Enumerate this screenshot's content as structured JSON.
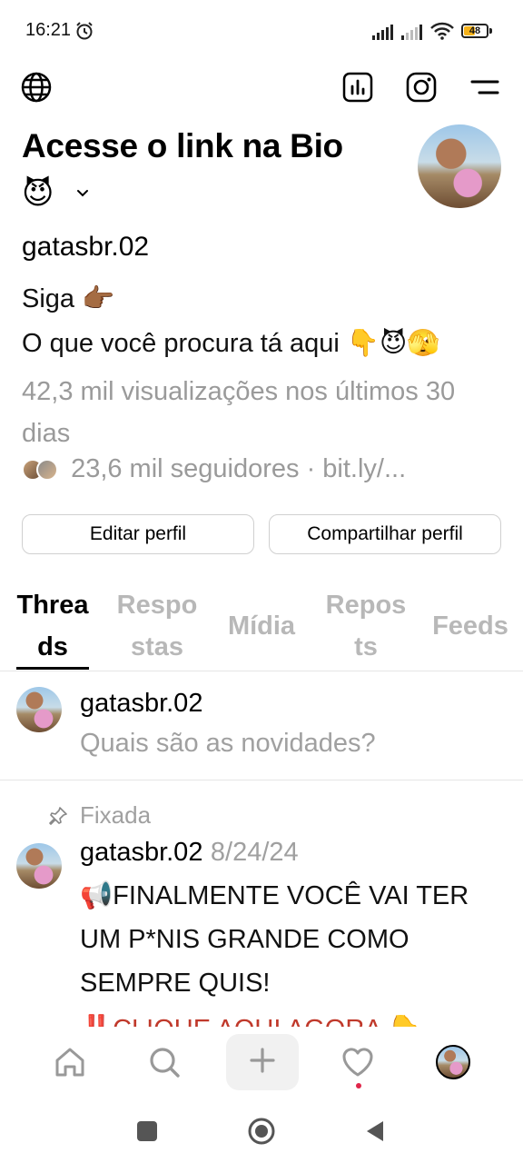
{
  "status_bar": {
    "time": "16:21",
    "battery": "48"
  },
  "profile": {
    "display_name": "Acesse o link na Bio",
    "name_emoji": "😈",
    "username": "gatasbr.02",
    "bio_line1": "Siga 👉🏾",
    "bio_line2": "O que você procura tá aqui 👇😈🫣",
    "views": "42,3 mil visualizações nos últimos 30 dias",
    "followers": "23,6 mil seguidores · bit.ly/..."
  },
  "buttons": {
    "edit": "Editar perfil",
    "share": "Compartilhar perfil"
  },
  "tabs": [
    {
      "label": "Threa ds"
    },
    {
      "label": "Respo stas"
    },
    {
      "label": "Mídia"
    },
    {
      "label": "Repos ts"
    },
    {
      "label": "Feeds"
    }
  ],
  "composer": {
    "username": "gatasbr.02",
    "placeholder": "Quais são as novidades?"
  },
  "post": {
    "pinned_label": "Fixada",
    "username": "gatasbr.02",
    "date": "8/24/24",
    "text": "📢FINALMENTE VOCÊ VAI TER UM P*NIS GRANDE COMO SEMPRE QUIS!",
    "next_line": "‼️CLIQUE AQUI AGORA 👇"
  },
  "colors": {
    "accent_dot": "#e0264a",
    "muted_text": "#9a9a9a",
    "battery": "#f5b21b"
  },
  "icons": [
    "globe-icon",
    "insights-icon",
    "instagram-icon",
    "menu-icon",
    "home-icon",
    "search-icon",
    "plus-icon",
    "heart-icon",
    "profile-avatar"
  ]
}
